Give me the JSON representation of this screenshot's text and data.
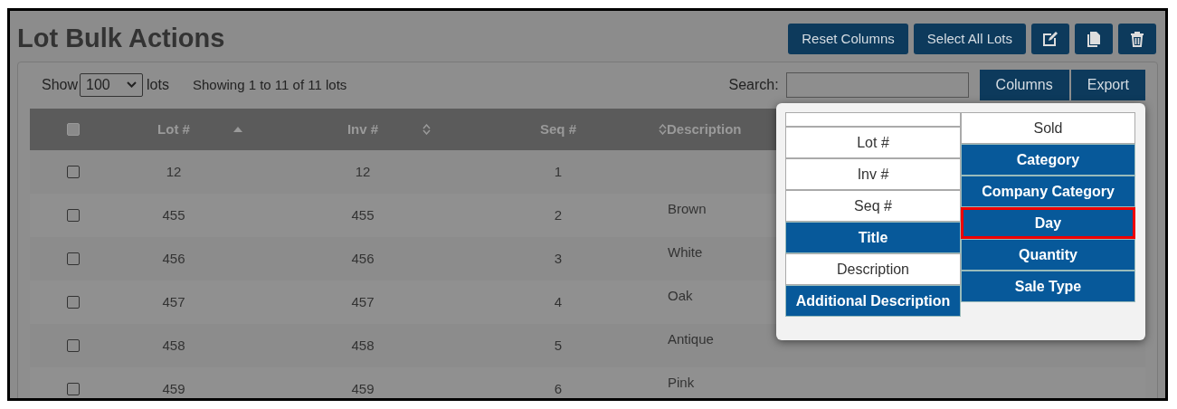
{
  "page_title": "Lot Bulk Actions",
  "toolbar": {
    "buttons": [
      {
        "kind": "text",
        "label": "Reset Columns"
      },
      {
        "kind": "text",
        "label": "Select All Lots"
      },
      {
        "kind": "edit"
      },
      {
        "kind": "copy"
      },
      {
        "kind": "delete"
      }
    ]
  },
  "length_control": {
    "prefix": "Show",
    "value": "100",
    "suffix": "lots"
  },
  "info": "Showing 1 to 11 of 11 lots",
  "search": {
    "label": "Search:"
  },
  "table_buttons": [
    "Columns",
    "Export"
  ],
  "table": {
    "select_all_checked": false,
    "columns": [
      {
        "label": "Lot #",
        "sorted": true
      },
      {
        "label": "Inv #",
        "sorted": false,
        "sortable": true
      },
      {
        "label": "Seq #",
        "sorted": false,
        "sortable": false
      },
      {
        "label": "Description",
        "sorted": false,
        "sortable": true
      }
    ],
    "rows": [
      {
        "checked": false,
        "cells": [
          "12",
          "12",
          "1",
          ""
        ]
      },
      {
        "checked": false,
        "cells": [
          "455",
          "455",
          "2",
          "Brown"
        ]
      },
      {
        "checked": false,
        "cells": [
          "456",
          "456",
          "3",
          "White"
        ]
      },
      {
        "checked": false,
        "cells": [
          "457",
          "457",
          "4",
          "Oak"
        ]
      },
      {
        "checked": false,
        "cells": [
          "458",
          "458",
          "5",
          "Antique"
        ]
      },
      {
        "checked": false,
        "cells": [
          "459",
          "459",
          "6",
          "Pink"
        ]
      }
    ]
  },
  "column_menu": {
    "columns": [
      [
        {
          "label": "Lot #",
          "selected": false,
          "highlighted": false
        },
        {
          "label": "Inv #",
          "selected": false,
          "highlighted": false
        },
        {
          "label": "Seq #",
          "selected": false,
          "highlighted": false
        },
        {
          "label": "Title",
          "selected": true,
          "highlighted": false
        },
        {
          "label": "Description",
          "selected": false,
          "highlighted": false
        },
        {
          "label": "Additional Description",
          "selected": true,
          "highlighted": false
        }
      ],
      [
        {
          "label": "Sold",
          "selected": false,
          "highlighted": false
        },
        {
          "label": "Category",
          "selected": true,
          "highlighted": false
        },
        {
          "label": "Company Category",
          "selected": true,
          "highlighted": false
        },
        {
          "label": "Day",
          "selected": true,
          "highlighted": true
        },
        {
          "label": "Quantity",
          "selected": true,
          "highlighted": false
        },
        {
          "label": "Sale Type",
          "selected": true,
          "highlighted": false
        }
      ]
    ]
  }
}
